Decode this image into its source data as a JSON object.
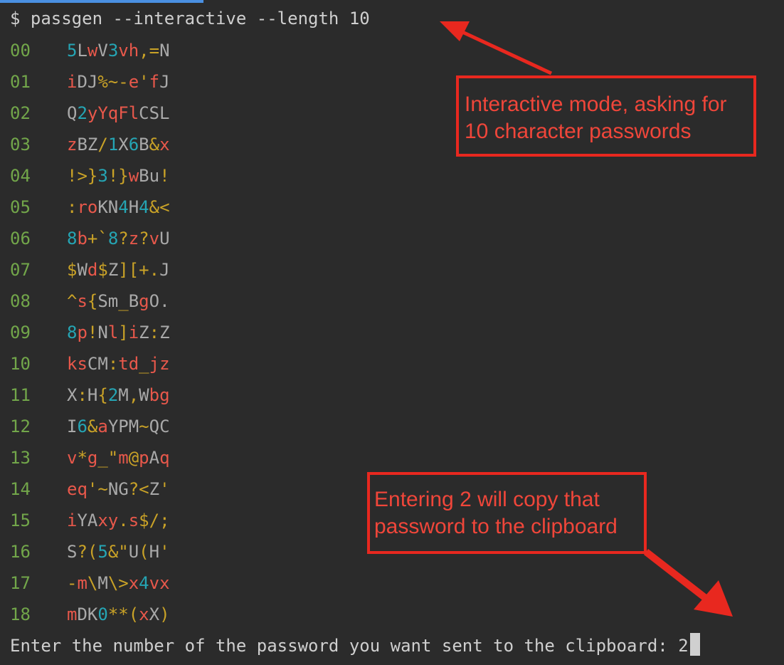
{
  "terminal": {
    "command": "$ passgen --interactive --length 10",
    "rows": [
      {
        "num": "00",
        "segments": [
          {
            "t": "5",
            "c": "c"
          },
          {
            "t": "L",
            "c": "w"
          },
          {
            "t": "w",
            "c": "r"
          },
          {
            "t": "V",
            "c": "w"
          },
          {
            "t": "3",
            "c": "c"
          },
          {
            "t": "vh",
            "c": "r"
          },
          {
            "t": ",=",
            "c": "y"
          },
          {
            "t": "N",
            "c": "w"
          }
        ]
      },
      {
        "num": "01",
        "segments": [
          {
            "t": "i",
            "c": "r"
          },
          {
            "t": "DJ",
            "c": "w"
          },
          {
            "t": "%~-",
            "c": "y"
          },
          {
            "t": "e",
            "c": "r"
          },
          {
            "t": "'",
            "c": "y"
          },
          {
            "t": "f",
            "c": "r"
          },
          {
            "t": "J",
            "c": "w"
          }
        ]
      },
      {
        "num": "02",
        "segments": [
          {
            "t": "Q",
            "c": "w"
          },
          {
            "t": "2",
            "c": "c"
          },
          {
            "t": "yYqF",
            "c": "r"
          },
          {
            "t": "l",
            "c": "r"
          },
          {
            "t": "CSL",
            "c": "w"
          }
        ]
      },
      {
        "num": "03",
        "segments": [
          {
            "t": "z",
            "c": "r"
          },
          {
            "t": "BZ",
            "c": "w"
          },
          {
            "t": "/",
            "c": "y"
          },
          {
            "t": "1",
            "c": "c"
          },
          {
            "t": "X",
            "c": "w"
          },
          {
            "t": "6",
            "c": "c"
          },
          {
            "t": "B",
            "c": "w"
          },
          {
            "t": "&",
            "c": "y"
          },
          {
            "t": "x",
            "c": "r"
          }
        ]
      },
      {
        "num": "04",
        "segments": [
          {
            "t": "!>}",
            "c": "y"
          },
          {
            "t": "3",
            "c": "c"
          },
          {
            "t": "!}",
            "c": "y"
          },
          {
            "t": "w",
            "c": "r"
          },
          {
            "t": "Bu",
            "c": "w"
          },
          {
            "t": "!",
            "c": "y"
          }
        ]
      },
      {
        "num": "05",
        "segments": [
          {
            "t": ":",
            "c": "y"
          },
          {
            "t": "ro",
            "c": "r"
          },
          {
            "t": "KN",
            "c": "w"
          },
          {
            "t": "4",
            "c": "c"
          },
          {
            "t": "H",
            "c": "w"
          },
          {
            "t": "4",
            "c": "c"
          },
          {
            "t": "&<",
            "c": "y"
          }
        ]
      },
      {
        "num": "06",
        "segments": [
          {
            "t": "8",
            "c": "c"
          },
          {
            "t": "b",
            "c": "r"
          },
          {
            "t": "+`",
            "c": "y"
          },
          {
            "t": "8",
            "c": "c"
          },
          {
            "t": "?",
            "c": "y"
          },
          {
            "t": "z",
            "c": "r"
          },
          {
            "t": "?",
            "c": "y"
          },
          {
            "t": "v",
            "c": "r"
          },
          {
            "t": "U",
            "c": "w"
          }
        ]
      },
      {
        "num": "07",
        "segments": [
          {
            "t": "$",
            "c": "y"
          },
          {
            "t": "W",
            "c": "w"
          },
          {
            "t": "d",
            "c": "r"
          },
          {
            "t": "$",
            "c": "y"
          },
          {
            "t": "Z",
            "c": "w"
          },
          {
            "t": "][+.",
            "c": "y"
          },
          {
            "t": "J",
            "c": "w"
          }
        ]
      },
      {
        "num": "08",
        "segments": [
          {
            "t": "^",
            "c": "y"
          },
          {
            "t": "s",
            "c": "r"
          },
          {
            "t": "{",
            "c": "y"
          },
          {
            "t": "Sm",
            "c": "w"
          },
          {
            "t": "_",
            "c": "y"
          },
          {
            "t": "B",
            "c": "w"
          },
          {
            "t": "g",
            "c": "r"
          },
          {
            "t": "O.",
            "c": "w"
          }
        ]
      },
      {
        "num": "09",
        "segments": [
          {
            "t": "8",
            "c": "c"
          },
          {
            "t": "p",
            "c": "r"
          },
          {
            "t": "!",
            "c": "y"
          },
          {
            "t": "N",
            "c": "w"
          },
          {
            "t": "l",
            "c": "r"
          },
          {
            "t": "]",
            "c": "y"
          },
          {
            "t": "i",
            "c": "r"
          },
          {
            "t": "Z",
            "c": "w"
          },
          {
            "t": ":",
            "c": "y"
          },
          {
            "t": "Z",
            "c": "w"
          }
        ]
      },
      {
        "num": "10",
        "segments": [
          {
            "t": "ks",
            "c": "r"
          },
          {
            "t": "CM",
            "c": "w"
          },
          {
            "t": ":",
            "c": "y"
          },
          {
            "t": "td",
            "c": "r"
          },
          {
            "t": "_",
            "c": "y"
          },
          {
            "t": "jz",
            "c": "r"
          }
        ]
      },
      {
        "num": "11",
        "segments": [
          {
            "t": "X",
            "c": "w"
          },
          {
            "t": ":",
            "c": "y"
          },
          {
            "t": "H",
            "c": "w"
          },
          {
            "t": "{",
            "c": "y"
          },
          {
            "t": "2",
            "c": "c"
          },
          {
            "t": "M",
            "c": "w"
          },
          {
            "t": ",",
            "c": "y"
          },
          {
            "t": "W",
            "c": "w"
          },
          {
            "t": "bg",
            "c": "r"
          }
        ]
      },
      {
        "num": "12",
        "segments": [
          {
            "t": "I",
            "c": "w"
          },
          {
            "t": "6",
            "c": "c"
          },
          {
            "t": "&",
            "c": "y"
          },
          {
            "t": "a",
            "c": "r"
          },
          {
            "t": "YPM",
            "c": "w"
          },
          {
            "t": "~",
            "c": "y"
          },
          {
            "t": "QC",
            "c": "w"
          }
        ]
      },
      {
        "num": "13",
        "segments": [
          {
            "t": "v",
            "c": "r"
          },
          {
            "t": "*",
            "c": "y"
          },
          {
            "t": "g",
            "c": "r"
          },
          {
            "t": "_\"",
            "c": "y"
          },
          {
            "t": "m",
            "c": "r"
          },
          {
            "t": "@",
            "c": "y"
          },
          {
            "t": "p",
            "c": "r"
          },
          {
            "t": "A",
            "c": "w"
          },
          {
            "t": "q",
            "c": "r"
          }
        ]
      },
      {
        "num": "14",
        "segments": [
          {
            "t": "eq",
            "c": "r"
          },
          {
            "t": "'~",
            "c": "y"
          },
          {
            "t": "NG",
            "c": "w"
          },
          {
            "t": "?<",
            "c": "y"
          },
          {
            "t": "Z",
            "c": "w"
          },
          {
            "t": "'",
            "c": "y"
          }
        ]
      },
      {
        "num": "15",
        "segments": [
          {
            "t": "i",
            "c": "r"
          },
          {
            "t": "YA",
            "c": "w"
          },
          {
            "t": "xy",
            "c": "r"
          },
          {
            "t": ".",
            "c": "y"
          },
          {
            "t": "s",
            "c": "r"
          },
          {
            "t": "$/;",
            "c": "y"
          }
        ]
      },
      {
        "num": "16",
        "segments": [
          {
            "t": "S",
            "c": "w"
          },
          {
            "t": "?(",
            "c": "y"
          },
          {
            "t": "5",
            "c": "c"
          },
          {
            "t": "&\"",
            "c": "y"
          },
          {
            "t": "U",
            "c": "w"
          },
          {
            "t": "(",
            "c": "y"
          },
          {
            "t": "H",
            "c": "w"
          },
          {
            "t": "'",
            "c": "y"
          }
        ]
      },
      {
        "num": "17",
        "segments": [
          {
            "t": "-",
            "c": "y"
          },
          {
            "t": "m",
            "c": "r"
          },
          {
            "t": "\\",
            "c": "y"
          },
          {
            "t": "M",
            "c": "w"
          },
          {
            "t": "\\>",
            "c": "y"
          },
          {
            "t": "x",
            "c": "r"
          },
          {
            "t": "4",
            "c": "c"
          },
          {
            "t": "vx",
            "c": "r"
          }
        ]
      },
      {
        "num": "18",
        "segments": [
          {
            "t": "m",
            "c": "r"
          },
          {
            "t": "DK",
            "c": "w"
          },
          {
            "t": "0",
            "c": "c"
          },
          {
            "t": "**(",
            "c": "y"
          },
          {
            "t": "x",
            "c": "r"
          },
          {
            "t": "X",
            "c": "w"
          },
          {
            "t": ")",
            "c": "y"
          }
        ]
      }
    ],
    "prompt_text": "Enter the number of the password you want sent to the clipboard: ",
    "prompt_value": "2"
  },
  "annotations": {
    "callout1": "Interactive mode, asking for\n10 character passwords",
    "callout2": "Entering 2 will copy that\npassword to the clipboard"
  },
  "colors": {
    "background": "#2b2b2b",
    "annotation": "#e8281f",
    "line_number": "#72a64a",
    "red": "#e8584b",
    "yellow": "#c9a227",
    "cyan": "#25a5b4",
    "gray": "#a9a9a9"
  }
}
